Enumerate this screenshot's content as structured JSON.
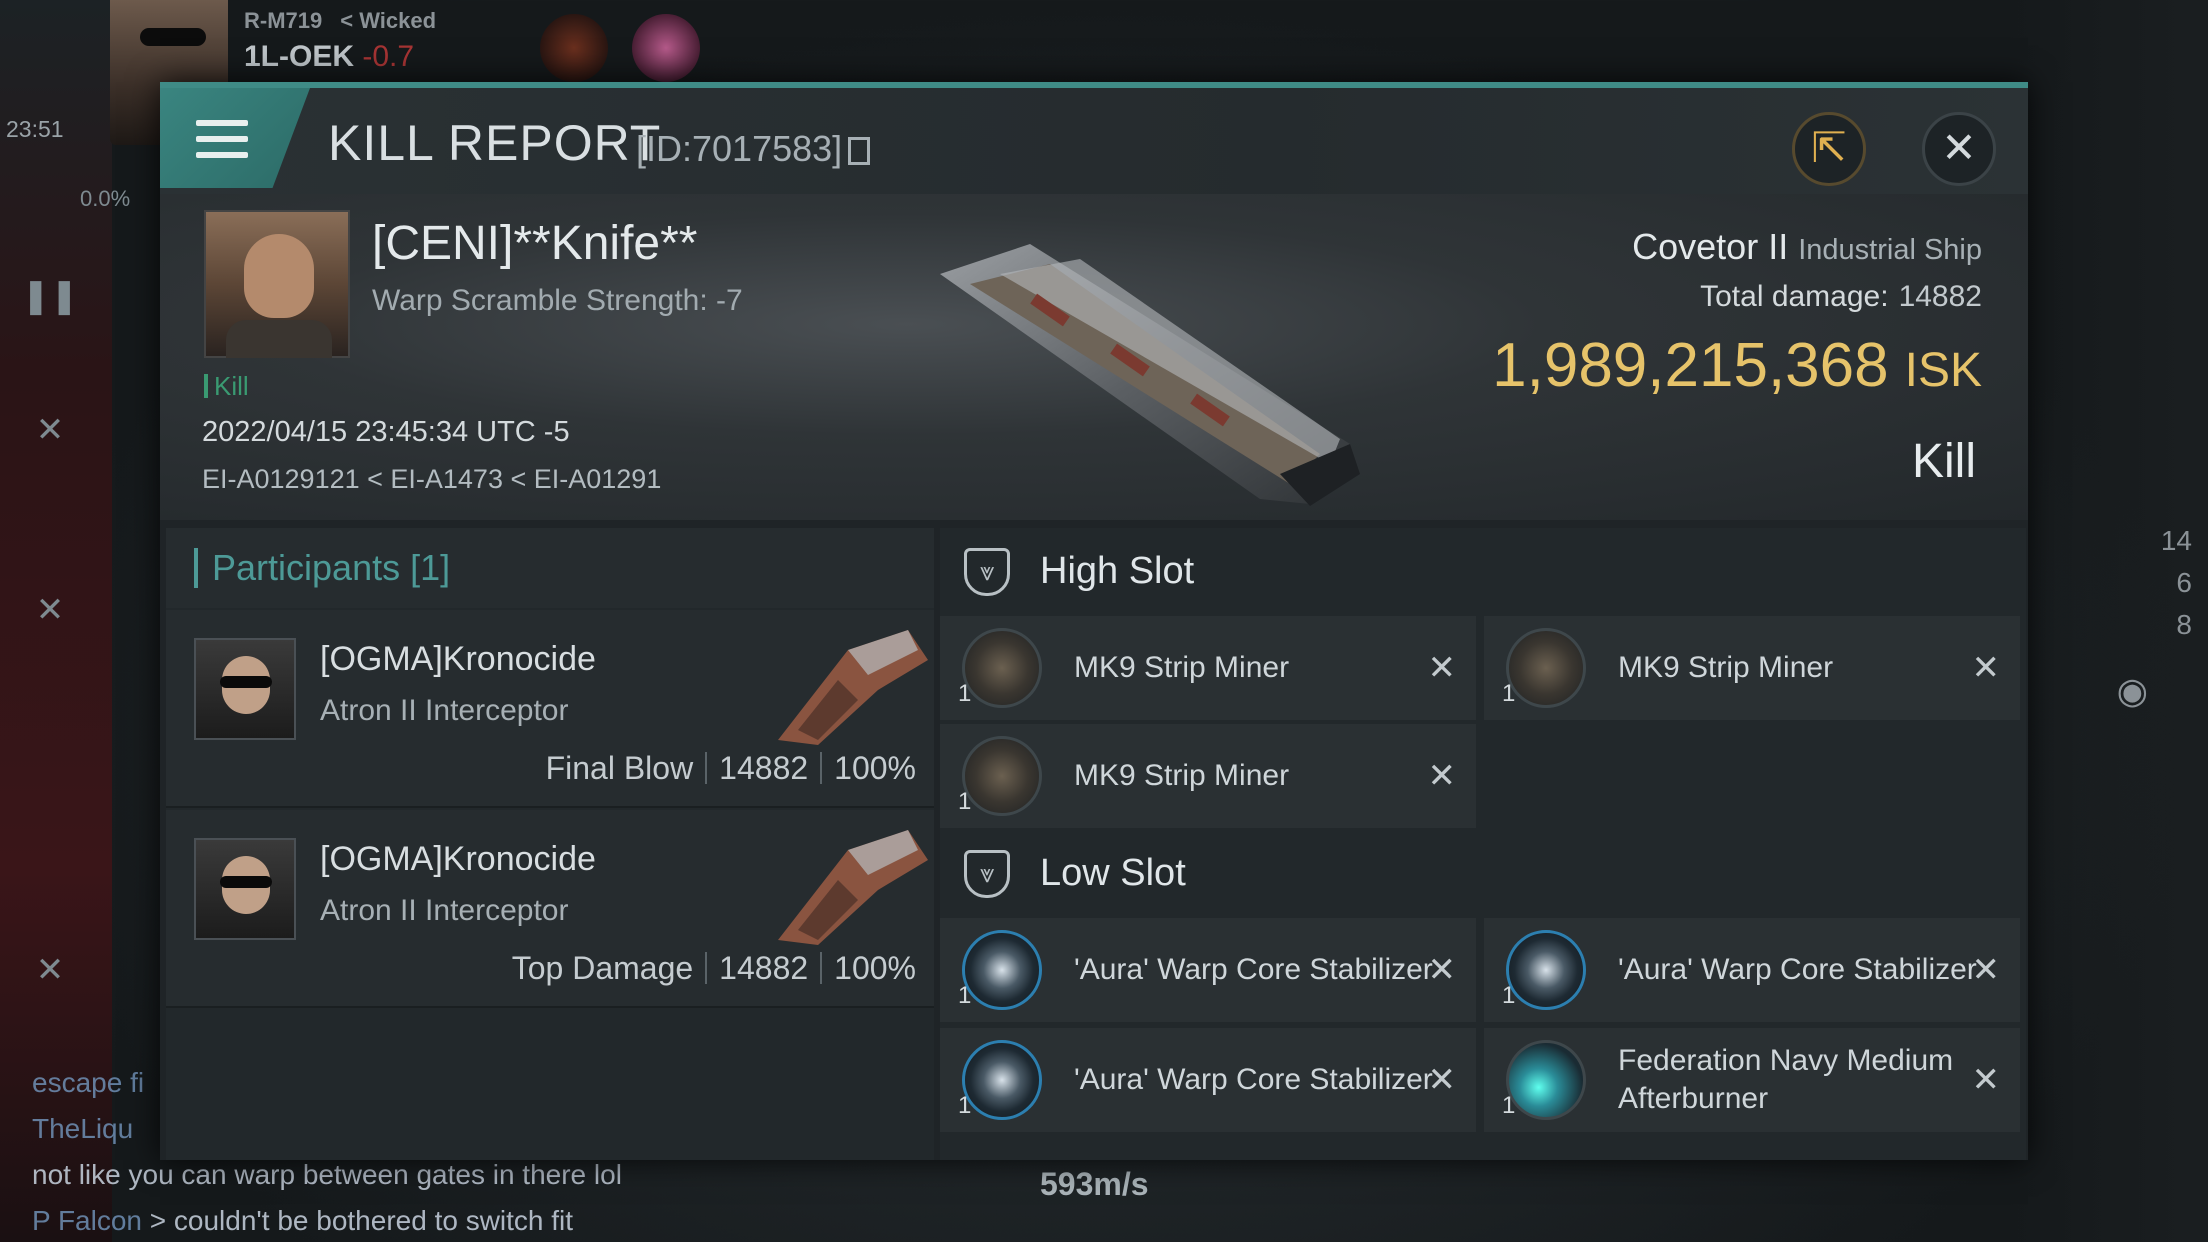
{
  "hud": {
    "system": "R-M719",
    "wicked": "< Wicked",
    "system2": "1L-OEK",
    "security": "-0.7",
    "time": "23:51",
    "cargo_pct": "0.0%",
    "stats": [
      "14",
      "6",
      "8"
    ],
    "speed": "593m/s",
    "chat": {
      "line1": "escape fi",
      "line2": "TheLiqu",
      "line3": "not like you can warp between gates in there lol",
      "line4_name": "P Falcon",
      "line4_text": " > couldn't be bothered to switch fit"
    }
  },
  "modal": {
    "title": "KILL REPORT",
    "id": "[ID:7017583]",
    "victim": {
      "name": "[CENI]**Knife**",
      "sub": "Warp Scramble Strength: -7",
      "kill_tag": "Kill",
      "datetime": "2022/04/15 23:45:34 UTC -5",
      "path": "EI-A0129121 < EI-A1473 < EI-A01291",
      "ship_name": "Covetor II",
      "ship_class": "Industrial Ship",
      "total_damage_label": "Total damage:",
      "total_damage": "14882",
      "isk_value": "1,989,215,368",
      "isk_unit": "ISK",
      "result": "Kill"
    },
    "participants": {
      "header": "Participants [1]",
      "rows": [
        {
          "name": "[OGMA]Kronocide",
          "ship": "Atron II Interceptor",
          "role": "Final Blow",
          "damage": "14882",
          "pct": "100%"
        },
        {
          "name": "[OGMA]Kronocide",
          "ship": "Atron II Interceptor",
          "role": "Top Damage",
          "damage": "14882",
          "pct": "100%"
        }
      ]
    },
    "fittings": {
      "high_slot": {
        "label": "High Slot",
        "items": [
          {
            "name": "MK9 Strip Miner",
            "qty": "1"
          },
          {
            "name": "MK9 Strip Miner",
            "qty": "1"
          },
          {
            "name": "MK9 Strip Miner",
            "qty": "1"
          }
        ]
      },
      "low_slot": {
        "label": "Low Slot",
        "items": [
          {
            "name": "'Aura' Warp Core Stabilizer",
            "qty": "1"
          },
          {
            "name": "'Aura' Warp Core Stabilizer",
            "qty": "1"
          },
          {
            "name": "'Aura' Warp Core Stabilizer",
            "qty": "1"
          },
          {
            "name": "Federation Navy Medium Afterburner",
            "qty": "1"
          }
        ]
      }
    }
  },
  "colors": {
    "accent": "#3f8b86",
    "isk": "#e6c36a",
    "kill_tag": "#3a9a72"
  }
}
